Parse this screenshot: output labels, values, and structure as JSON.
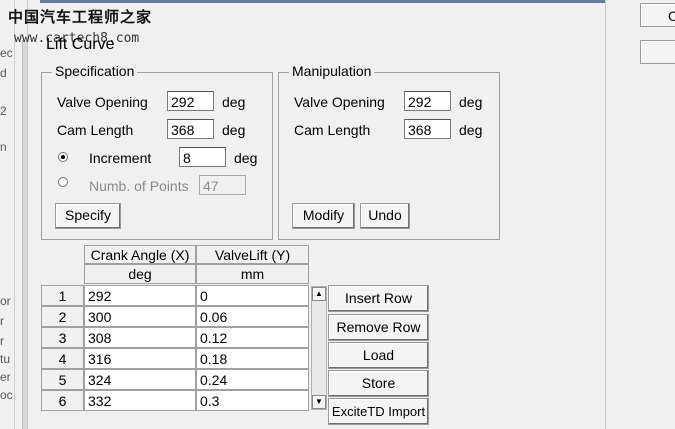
{
  "watermark": {
    "text": "中国汽车工程师之家",
    "url": "www.cartech8.com"
  },
  "dialog_title": "Lift Curve",
  "left_strip_fragments": [
    "ec",
    "d",
    "2",
    "n",
    "or",
    "r",
    "r",
    "tu",
    "er",
    "oc"
  ],
  "specification": {
    "legend": "Specification",
    "valve_opening_label": "Valve Opening",
    "valve_opening_value": "292",
    "valve_opening_unit": "deg",
    "cam_length_label": "Cam Length",
    "cam_length_value": "368",
    "cam_length_unit": "deg",
    "increment_label": "Increment",
    "increment_value": "8",
    "increment_unit": "deg",
    "points_label": "Numb. of Points",
    "points_value": "47",
    "specify_label": "Specify"
  },
  "manipulation": {
    "legend": "Manipulation",
    "valve_opening_label": "Valve Opening",
    "valve_opening_value": "292",
    "valve_opening_unit": "deg",
    "cam_length_label": "Cam Length",
    "cam_length_value": "368",
    "cam_length_unit": "deg",
    "modify_label": "Modify",
    "undo_label": "Undo"
  },
  "table": {
    "col1_header": "Crank Angle (X)",
    "col1_unit": "deg",
    "col2_header": "ValveLift (Y)",
    "col2_unit": "mm",
    "rows": [
      {
        "n": "1",
        "x": "292",
        "y": "0"
      },
      {
        "n": "2",
        "x": "300",
        "y": "0.06"
      },
      {
        "n": "3",
        "x": "308",
        "y": "0.12"
      },
      {
        "n": "4",
        "x": "316",
        "y": "0.18"
      },
      {
        "n": "5",
        "x": "324",
        "y": "0.24"
      },
      {
        "n": "6",
        "x": "332",
        "y": "0.3"
      }
    ]
  },
  "actions": {
    "insert_row": "Insert Row",
    "remove_row": "Remove Row",
    "load": "Load",
    "store": "Store",
    "excite_import": "ExciteTD Import"
  },
  "right_buttons": [
    "O",
    ""
  ]
}
